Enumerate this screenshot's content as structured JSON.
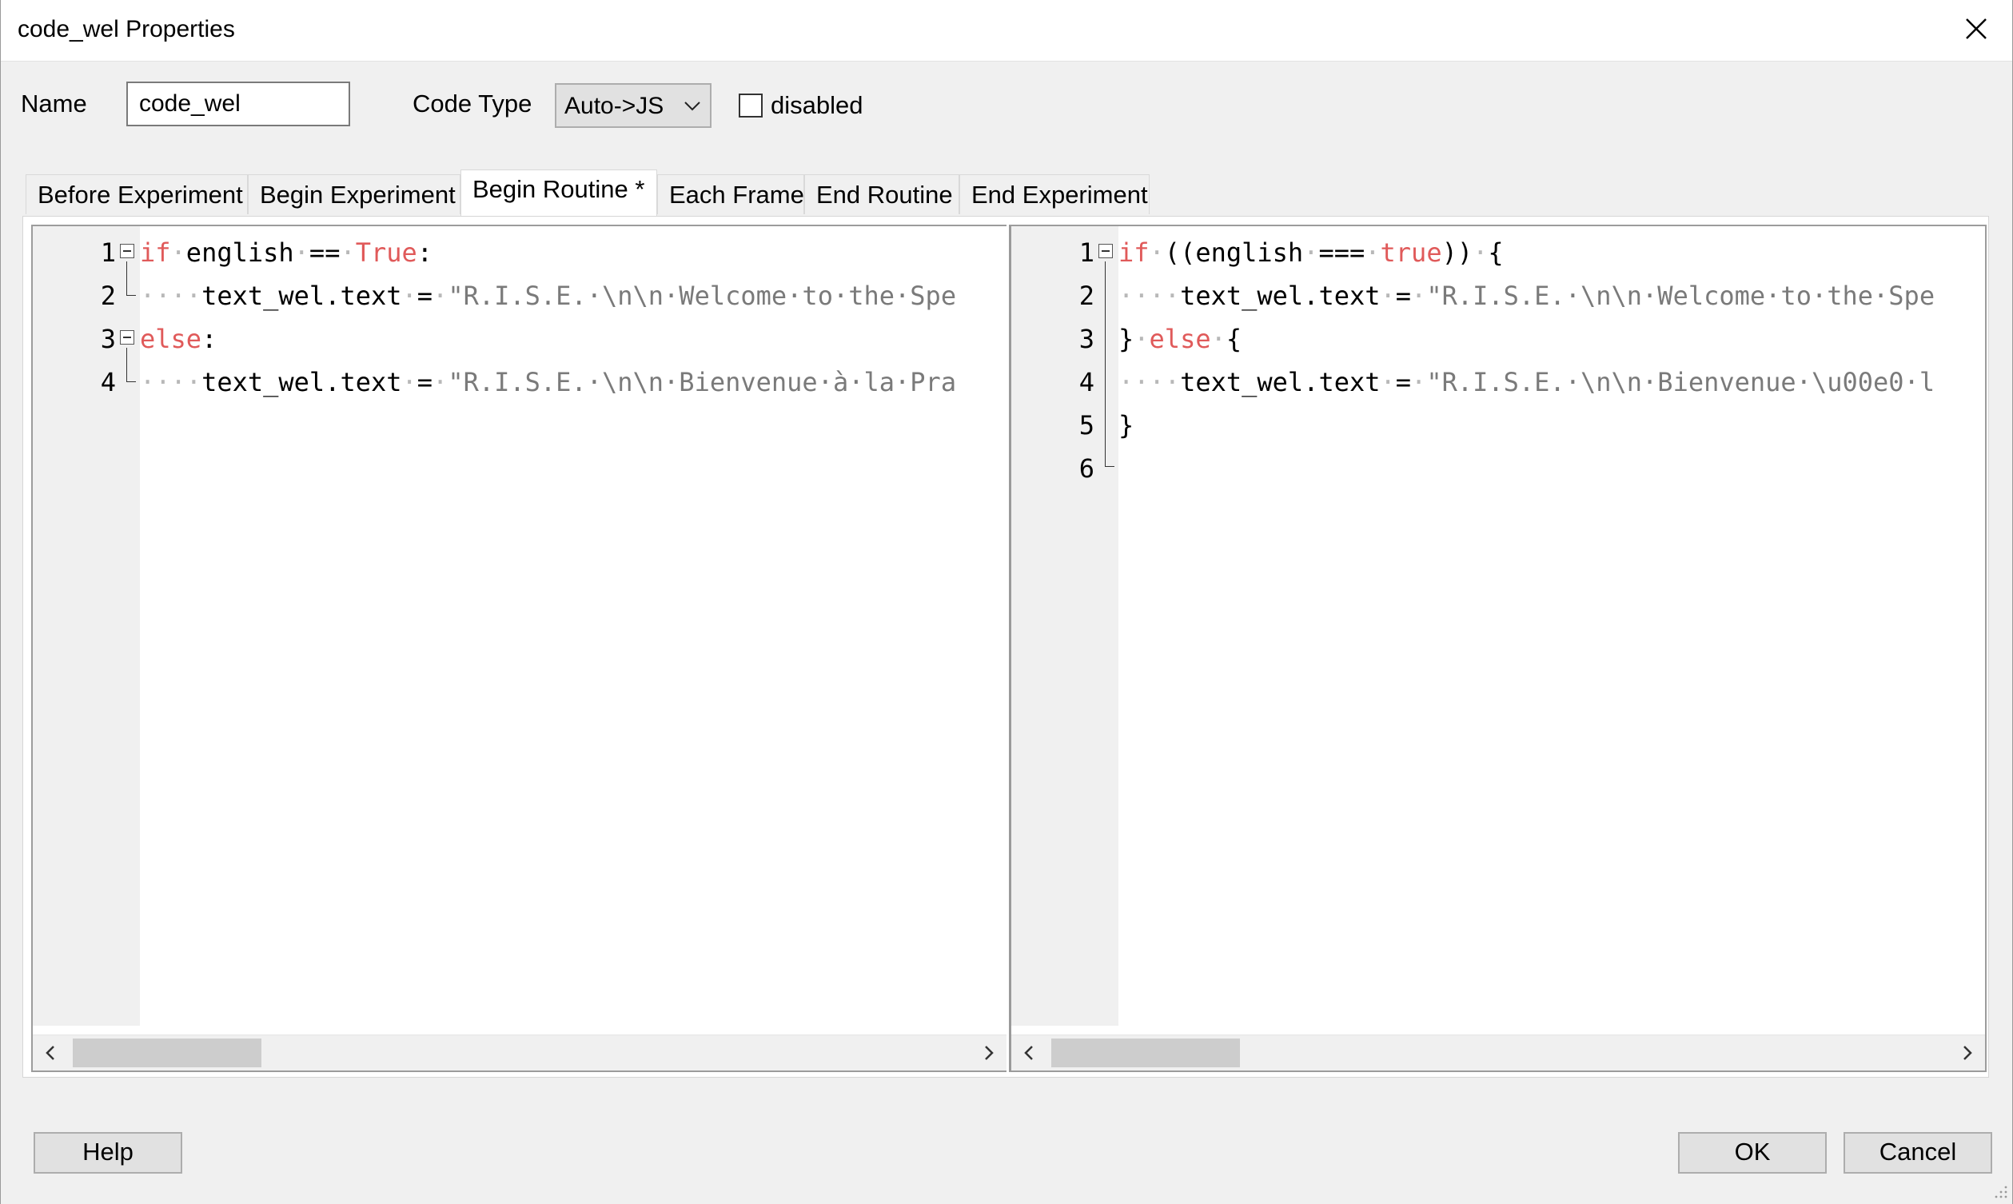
{
  "window": {
    "title": "code_wel Properties"
  },
  "form": {
    "name_label": "Name",
    "name_value": "code_wel",
    "code_type_label": "Code Type",
    "code_type_value": "Auto->JS",
    "disabled_label": "disabled",
    "disabled_checked": false
  },
  "tabs": [
    {
      "label": "Before Experiment",
      "active": false
    },
    {
      "label": "Begin Experiment",
      "active": false
    },
    {
      "label": "Begin Routine *",
      "active": true
    },
    {
      "label": "Each Frame",
      "active": false
    },
    {
      "label": "End Routine",
      "active": false
    },
    {
      "label": "End Experiment",
      "active": false
    }
  ],
  "editors": {
    "python": {
      "lines": [
        [
          {
            "t": "kw",
            "s": "if"
          },
          {
            "t": "ws",
            "s": "·"
          },
          {
            "t": "tx",
            "s": "english"
          },
          {
            "t": "ws",
            "s": "·"
          },
          {
            "t": "tx",
            "s": "=="
          },
          {
            "t": "ws",
            "s": "·"
          },
          {
            "t": "kw",
            "s": "True"
          },
          {
            "t": "tx",
            "s": ":"
          }
        ],
        [
          {
            "t": "ws",
            "s": "····"
          },
          {
            "t": "tx",
            "s": "text_wel.text"
          },
          {
            "t": "ws",
            "s": "·"
          },
          {
            "t": "tx",
            "s": "="
          },
          {
            "t": "ws",
            "s": "·"
          },
          {
            "t": "str",
            "s": "\"R.I.S.E.·\\n\\n·Welcome·to·the·Spe"
          }
        ],
        [
          {
            "t": "kw",
            "s": "else"
          },
          {
            "t": "tx",
            "s": ":"
          }
        ],
        [
          {
            "t": "ws",
            "s": "····"
          },
          {
            "t": "tx",
            "s": "text_wel.text"
          },
          {
            "t": "ws",
            "s": "·"
          },
          {
            "t": "tx",
            "s": "="
          },
          {
            "t": "ws",
            "s": "·"
          },
          {
            "t": "str",
            "s": "\"R.I.S.E.·\\n\\n·Bienvenue·à·la·Pra"
          }
        ]
      ]
    },
    "javascript": {
      "lines": [
        [
          {
            "t": "kw",
            "s": "if"
          },
          {
            "t": "ws",
            "s": "·"
          },
          {
            "t": "tx",
            "s": "((english"
          },
          {
            "t": "ws",
            "s": "·"
          },
          {
            "t": "tx",
            "s": "==="
          },
          {
            "t": "ws",
            "s": "·"
          },
          {
            "t": "kw",
            "s": "true"
          },
          {
            "t": "tx",
            "s": "))"
          },
          {
            "t": "ws",
            "s": "·"
          },
          {
            "t": "tx",
            "s": "{"
          }
        ],
        [
          {
            "t": "ws",
            "s": "····"
          },
          {
            "t": "tx",
            "s": "text_wel.text"
          },
          {
            "t": "ws",
            "s": "·"
          },
          {
            "t": "tx",
            "s": "="
          },
          {
            "t": "ws",
            "s": "·"
          },
          {
            "t": "str",
            "s": "\"R.I.S.E.·\\n\\n·Welcome·to·the·Spe"
          }
        ],
        [
          {
            "t": "tx",
            "s": "}"
          },
          {
            "t": "ws",
            "s": "·"
          },
          {
            "t": "kw",
            "s": "else"
          },
          {
            "t": "ws",
            "s": "·"
          },
          {
            "t": "tx",
            "s": "{"
          }
        ],
        [
          {
            "t": "ws",
            "s": "····"
          },
          {
            "t": "tx",
            "s": "text_wel.text"
          },
          {
            "t": "ws",
            "s": "·"
          },
          {
            "t": "tx",
            "s": "="
          },
          {
            "t": "ws",
            "s": "·"
          },
          {
            "t": "str",
            "s": "\"R.I.S.E.·\\n\\n·Bienvenue·\\u00e0·l"
          }
        ],
        [
          {
            "t": "tx",
            "s": "}"
          }
        ],
        []
      ]
    }
  },
  "buttons": {
    "help": "Help",
    "ok": "OK",
    "cancel": "Cancel"
  },
  "icons": {
    "close": "close-icon",
    "dropdown": "chevron-down-icon",
    "scroll_left": "chevron-left-icon",
    "scroll_right": "chevron-right-icon",
    "resize": "resize-grip-icon"
  },
  "colors": {
    "keyword": "#e05a5a",
    "string": "#7a7a7a",
    "whitespace": "#b8b8b8"
  }
}
